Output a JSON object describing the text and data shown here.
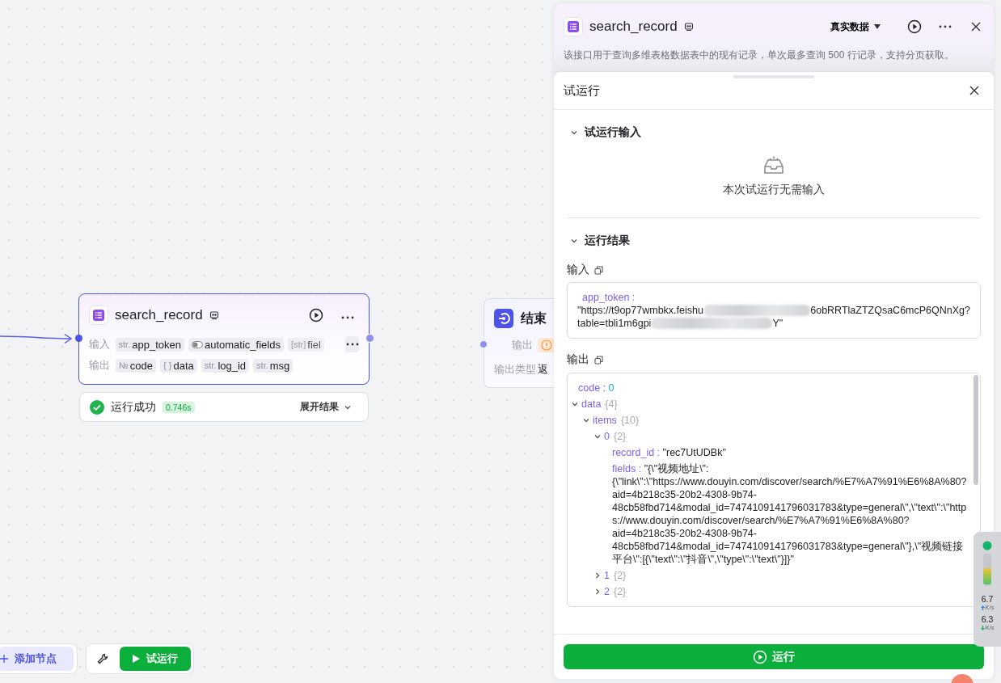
{
  "canvas": {
    "tool_node": {
      "title": "search_record",
      "selected": true,
      "inputs_label": "输入",
      "inputs": [
        {
          "kind": "typed",
          "type": "str.",
          "name": "app_token"
        },
        {
          "kind": "toggle",
          "name": "automatic_fields"
        },
        {
          "kind": "typed",
          "type": "[str]",
          "name": "fiel"
        }
      ],
      "outputs_label": "输出",
      "outputs": [
        {
          "kind": "typed",
          "type": "№",
          "name": "code"
        },
        {
          "kind": "typed",
          "type": "{ }",
          "name": "data"
        },
        {
          "kind": "typed",
          "type": "str.",
          "name": "log_id"
        },
        {
          "kind": "typed",
          "type": "str.",
          "name": "msg"
        }
      ],
      "status": {
        "text": "运行成功",
        "time": "0.746s",
        "expand": "展开结果"
      }
    },
    "end_node": {
      "title": "结束",
      "selected": false,
      "output_label": "输出",
      "type_label": "输出类型",
      "type_value": "返"
    },
    "toolbar": {
      "add_node": "添加节点",
      "test_run": "试运行"
    }
  },
  "panel": {
    "title": "search_record",
    "data_mode": "真实数据",
    "description": "该接口用于查询多维表格数据表中的现有记录，单次最多查询 500 行记录，支持分页获取。",
    "test_run": {
      "title": "试运行",
      "input_section": {
        "title": "试运行输入",
        "expanded": true,
        "empty_text": "本次试运行无需输入"
      },
      "result_section": {
        "title": "运行结果",
        "expanded": true,
        "input_label": "输入",
        "input_key": "app_token :",
        "input_lines": [
          [
            "\"https://t9op77wmbkx.feishu",
            "6obRRTlaZTZQsaC6mcP6QNnXg?"
          ],
          [
            "table=tbli1m6gpi",
            "Y\""
          ]
        ],
        "output_label": "输出",
        "output_tree": [
          {
            "key": "code :",
            "value": "0",
            "kind": "number"
          },
          {
            "key": "data",
            "count": "{4}",
            "expanded": true,
            "children": [
              {
                "key": "items",
                "count": "{10}",
                "expanded": true,
                "children": [
                  {
                    "key": "0",
                    "count": "{2}",
                    "expanded": true,
                    "children": [
                      {
                        "key": "record_id :",
                        "value": "\"rec7UtUDBk\""
                      },
                      {
                        "key": "fields :",
                        "value": "\"{\\\"视频地址\\\":{\\\"link\\\":\\\"https://www.douyin.com/discover/search/%E7%A7%91%E6%8A%80?aid=4b218c35-20b2-4308-9b74-48cb58fbd714&modal_id=7474109141796031783&type=general\\\",\\\"text\\\":\\\"https://www.douyin.com/discover/search/%E7%A7%91%E6%8A%80?aid=4b218c35-20b2-4308-9b74-48cb58fbd714&modal_id=7474109141796031783&type=general\\\"},\\\"视频链接平台\\\":[{\\\"text\\\":\\\"抖音\\\",\\\"type\\\":\\\"text\\\"}]}\""
                      }
                    ]
                  },
                  {
                    "key": "1",
                    "count": "{2}",
                    "expanded": false
                  },
                  {
                    "key": "2",
                    "count": "{2}",
                    "expanded": false
                  }
                ]
              }
            ]
          }
        ]
      },
      "run_button": "运行"
    }
  },
  "net_widget": {
    "up": "6.7",
    "up_unit": "K/s",
    "down": "6.3",
    "down_unit": "K/s"
  }
}
